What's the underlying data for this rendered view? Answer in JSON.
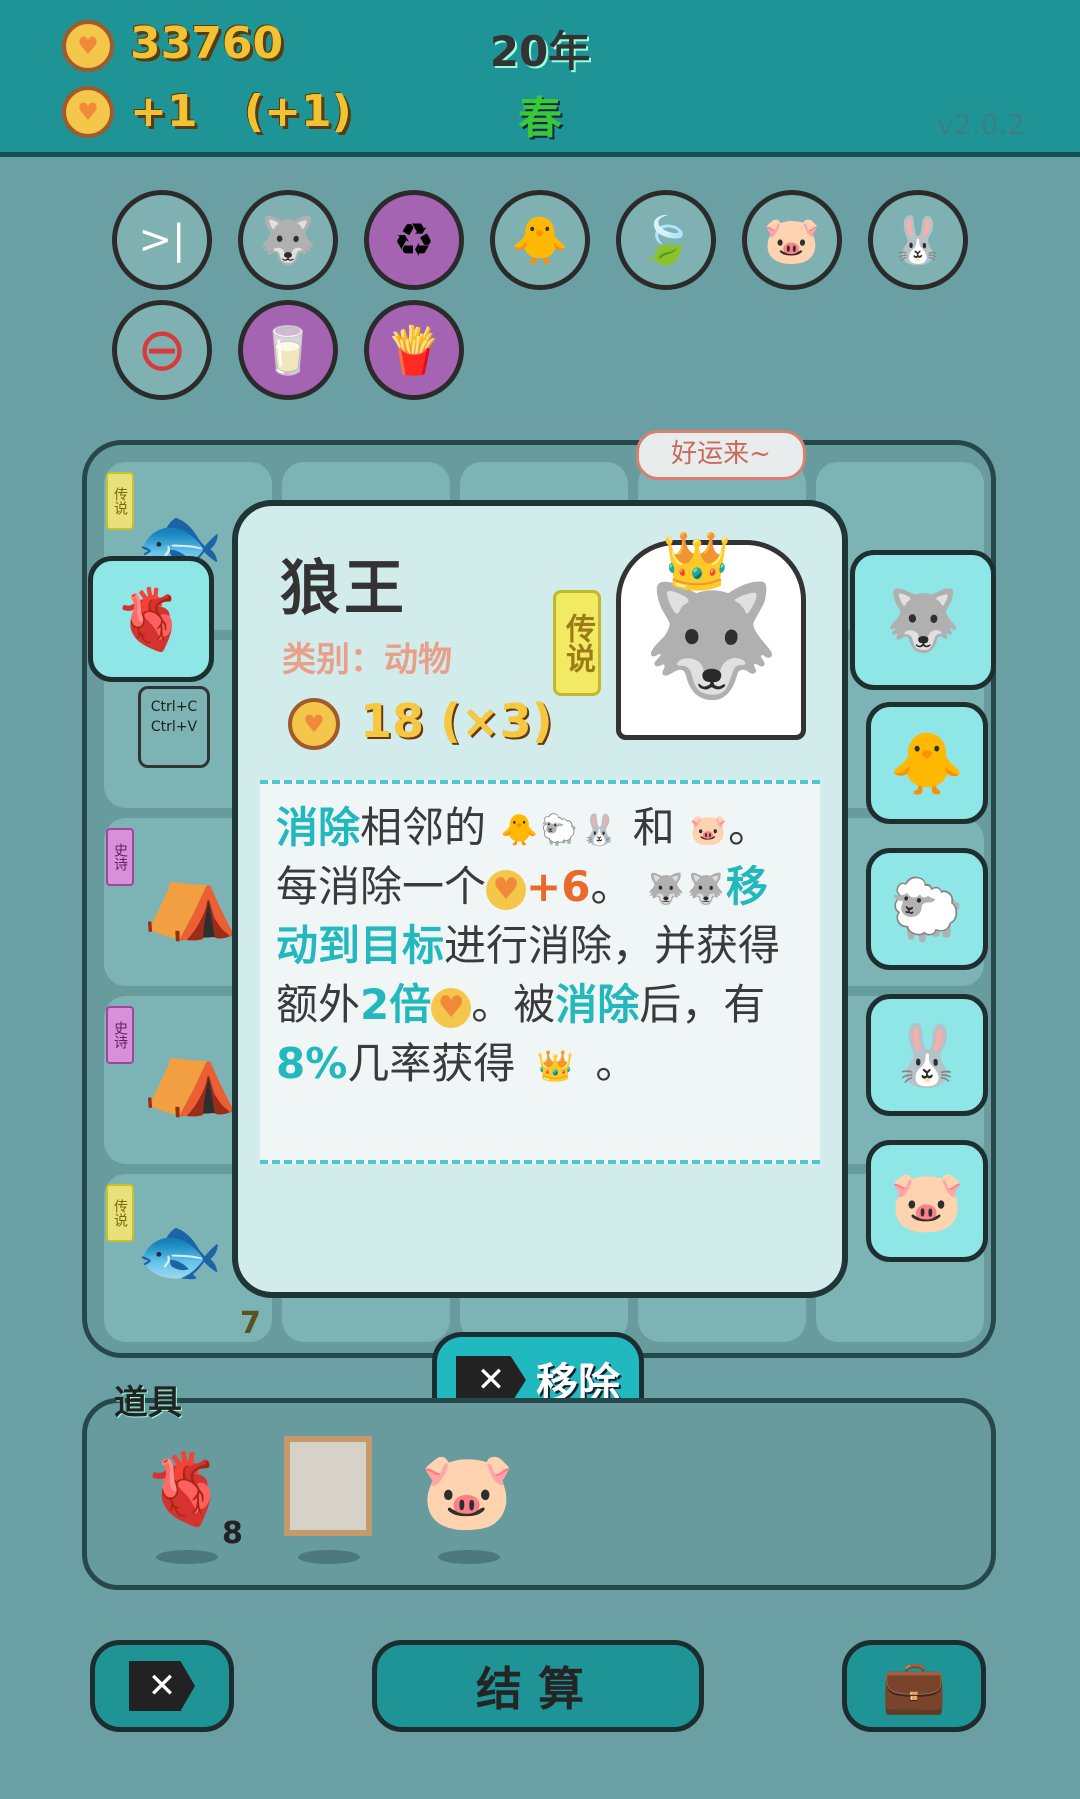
{
  "top": {
    "coins": "33760",
    "income": "+1",
    "income_bonus": "(+1)",
    "year": "20年",
    "season": "春",
    "version": "v2.0.2"
  },
  "tools": [
    {
      "icon": "skip-icon",
      "glyph": ">|",
      "bg": "#7fb0b2"
    },
    {
      "icon": "wolf-icon",
      "glyph": "🐺",
      "bg": "#7fb0b2"
    },
    {
      "icon": "recycle-icon",
      "glyph": "♻",
      "bg": "#a564b2"
    },
    {
      "icon": "chick-egg-icon",
      "glyph": "🐥",
      "bg": "#7fb0b2"
    },
    {
      "icon": "leaf-icon",
      "glyph": "🍃",
      "bg": "#7fb0b2"
    },
    {
      "icon": "piggy-bank-icon",
      "glyph": "🐷",
      "bg": "#7fb0b2"
    },
    {
      "icon": "rabbit-icon",
      "glyph": "🐰",
      "bg": "#7fb0b2"
    },
    {
      "icon": "remove-circle-icon",
      "glyph": "⊖",
      "bg": "#7fb0b2"
    },
    {
      "icon": "milk-jar-icon",
      "glyph": "🥛",
      "bg": "#a564b2"
    },
    {
      "icon": "fries-icon",
      "glyph": "🍟",
      "bg": "#a564b2"
    }
  ],
  "board": {
    "speech": "好运来~",
    "tag_legend": "传说",
    "tag_epic": "史诗",
    "keys_text": "Ctrl+C Ctrl+V",
    "count_label": "7"
  },
  "popup": {
    "name": "狼王",
    "category": "类别：动物",
    "value": "18 (×3)",
    "rarity": "传说",
    "desc": {
      "t1": "消除",
      "t2": "相邻的",
      "t3": "和",
      "t4": "。每消除一个",
      "t5": "+6",
      "t6": "。",
      "t7": "移动到目标",
      "t8": "进行消除，并获得额外",
      "t9": "2倍",
      "t10": "。被",
      "t11": "消除",
      "t12": "后，有",
      "t13": "8%",
      "t14": "几率获得",
      "t15": "。"
    },
    "remove_button": "移除"
  },
  "items": {
    "title": "道具",
    "liver_count": "8"
  },
  "bottom": {
    "settle_label": "结算"
  }
}
